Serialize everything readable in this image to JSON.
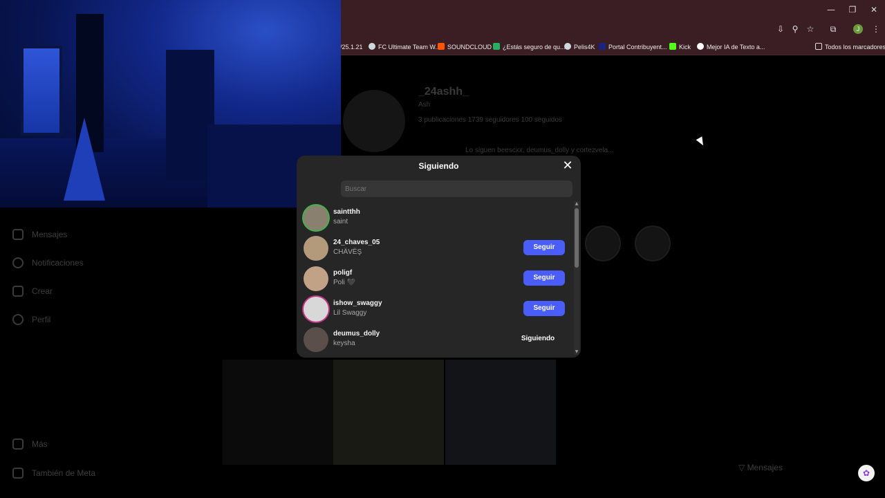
{
  "browser": {
    "bookmarks": [
      {
        "label": "/25.1.21",
        "color": "#3b1d24"
      },
      {
        "label": "FC Ultimate Team W...",
        "color": "#cfd8dc"
      },
      {
        "label": "SOUNDCLOUD",
        "color": "#ff5500"
      },
      {
        "label": "¿Estás seguro de qu...",
        "color": "#27ae60"
      },
      {
        "label": "Pelis4K",
        "color": "#cfd8dc"
      },
      {
        "label": "Portal Contribuyent...",
        "color": "#1a237e"
      },
      {
        "label": "Kick",
        "color": "#53fc18"
      },
      {
        "label": "Mejor IA de Texto a...",
        "color": "#ffffff"
      }
    ],
    "all_bookmarks": "Todos los marcadores"
  },
  "background": {
    "profile_username": "_24ashh_",
    "profile_name": "Ash",
    "stats": "3 publicaciones   1739 seguidores   100 seguidos",
    "followed_by": "Lo siguen beescxx, deumus_dolly y cortezvela...",
    "sidebar": [
      "Mensajes",
      "Notificaciones",
      "Crear",
      "Perfil"
    ],
    "sidebar_bottom": [
      "Más",
      "También de Meta"
    ],
    "messages_label": "Mensajes"
  },
  "modal": {
    "title": "Siguiendo",
    "search_placeholder": "Buscar",
    "users": [
      {
        "username": "saintthh",
        "name": "saint",
        "button": "",
        "avatar_color": "#8a8070",
        "ring": "green"
      },
      {
        "username": "24_chaves_05",
        "name": "CHÄVËŞ",
        "button": "Seguir",
        "avatar_color": "#b39a7a",
        "ring": "none"
      },
      {
        "username": "poligf",
        "name": "Poli 🖤",
        "button": "Seguir",
        "avatar_color": "#c2a287",
        "ring": "none"
      },
      {
        "username": "ishow_swaggy",
        "name": "Lil Swaggy",
        "button": "Seguir",
        "avatar_color": "#d8d8d8",
        "ring": "story"
      },
      {
        "username": "deumus_dolly",
        "name": "keysha",
        "button": "Siguiendo",
        "avatar_color": "#5a4f4a",
        "ring": "none"
      }
    ]
  },
  "colors": {
    "follow_button": "#4a5df9",
    "modal_bg": "#262626",
    "chrome_bg": "#3b1d24"
  }
}
